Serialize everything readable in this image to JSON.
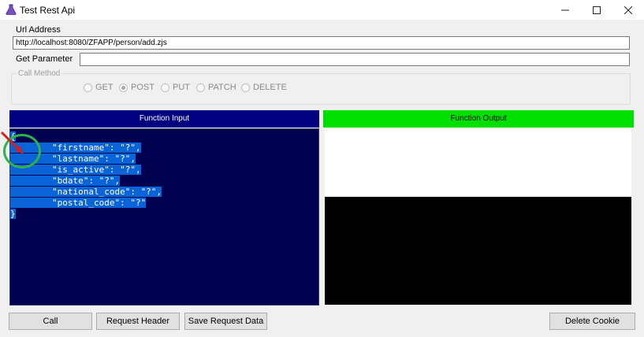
{
  "window": {
    "title": "Test Rest Api",
    "icon": "flask-icon",
    "controls": {
      "minimize": "─",
      "maximize": "☐",
      "close": "✕"
    }
  },
  "form": {
    "url_label": "Url Address",
    "url_value": "http://localhost:8080/ZFAPP/person/add.zjs",
    "param_label": "Get Parameter",
    "param_value": ""
  },
  "call_method": {
    "legend": "Call Method",
    "options": [
      "GET",
      "POST",
      "PUT",
      "PATCH",
      "DELETE"
    ],
    "selected": "POST"
  },
  "input_panel": {
    "header": "Function Input",
    "header_color": "#000080",
    "code_lines": [
      "{",
      "        \"firstname\": \"?\",",
      "        \"lastname\": \"?\",",
      "        \"is_active\": \"?\",",
      "        \"bdate\": \"?\",",
      "        \"national_code\": \"?\",",
      "        \"postal_code\": \"?\"",
      "}"
    ]
  },
  "output_panel": {
    "header": "Function Output",
    "header_color": "#00e000"
  },
  "buttons": {
    "call": "Call",
    "request_header": "Request Header",
    "save_request_data": "Save Request Data",
    "delete_cookie": "Delete Cookie"
  },
  "colors": {
    "selection": "#0a64d8",
    "editor_bg": "#000050",
    "annotation_circle": "#2db34a",
    "annotation_arrow": "#d02020"
  }
}
